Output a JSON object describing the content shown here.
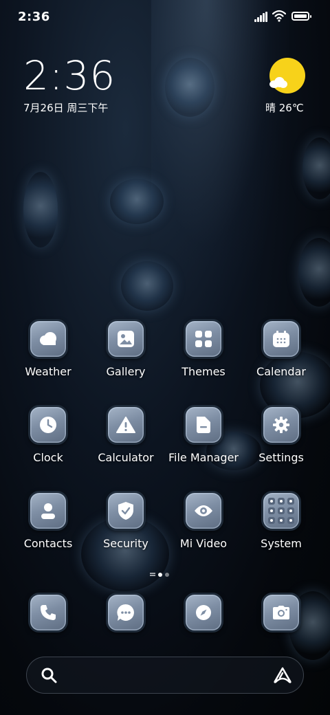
{
  "status_bar": {
    "time": "2:36",
    "battery_level": 1.0
  },
  "clock_widget": {
    "time": "2:36",
    "date": "7月26日 周三下午"
  },
  "weather_widget": {
    "condition": "晴",
    "temperature": "26℃",
    "text": "晴 26℃",
    "icon": "sun-cloud-icon",
    "sun_color": "#f7d21a"
  },
  "apps": [
    {
      "label": "Weather",
      "icon": "weather-icon"
    },
    {
      "label": "Gallery",
      "icon": "gallery-icon"
    },
    {
      "label": "Themes",
      "icon": "themes-icon"
    },
    {
      "label": "Calendar",
      "icon": "calendar-icon"
    },
    {
      "label": "Clock",
      "icon": "clock-icon"
    },
    {
      "label": "Calculator",
      "icon": "warning-icon"
    },
    {
      "label": "File Manager",
      "icon": "folder-icon"
    },
    {
      "label": "Settings",
      "icon": "gear-icon"
    },
    {
      "label": "Contacts",
      "icon": "contact-icon"
    },
    {
      "label": "Security",
      "icon": "shield-icon"
    },
    {
      "label": "Mi Video",
      "icon": "eye-icon"
    },
    {
      "label": "System",
      "icon": "folder-grid-icon"
    }
  ],
  "dock": [
    {
      "icon": "phone-icon"
    },
    {
      "icon": "message-icon"
    },
    {
      "icon": "compass-icon"
    },
    {
      "icon": "camera-icon"
    }
  ],
  "page_indicator": {
    "current": 1,
    "total": 2
  },
  "search_bar": {
    "left_icon": "search-icon",
    "right_icon": "assistant-icon"
  },
  "colors": {
    "tile_top": "#a5b4c7",
    "tile_bottom": "#5e6d82",
    "tile_border": "#1e2a38"
  }
}
